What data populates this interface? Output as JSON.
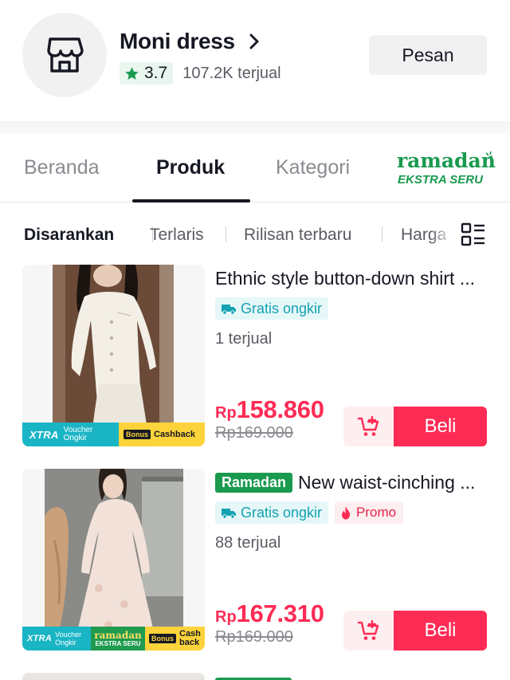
{
  "shop": {
    "name": "Moni dress",
    "rating": "3.7",
    "sold": "107.2K terjual",
    "message_button": "Pesan"
  },
  "tabs": [
    {
      "label": "Beranda",
      "active": false
    },
    {
      "label": "Produk",
      "active": true
    },
    {
      "label": "Kategori",
      "active": false
    }
  ],
  "campaign_tab": {
    "line1": "ramadan",
    "line2": "EKSTRA SERU"
  },
  "sort": {
    "options": [
      "Disarankan",
      "Terlaris",
      "Rilisan terbaru",
      "Harga"
    ],
    "active": "Disarankan"
  },
  "products": [
    {
      "title": "Ethnic style button-down shirt ...",
      "label_badge": "",
      "shipping_tag": "Gratis ongkir",
      "promo_tag": "",
      "sold": "1 terjual",
      "price_prefix": "Rp",
      "price": "158.860",
      "original_price": "Rp169.000",
      "banner": {
        "xtra": "XTRA",
        "voucher": "Voucher",
        "ongkir": "Ongkir",
        "bonus": "Bonus",
        "cashback": "Cashback"
      },
      "buy_label": "Beli"
    },
    {
      "title": "New waist-cinching ...",
      "label_badge": "Ramadan",
      "shipping_tag": "Gratis ongkir",
      "promo_tag": "Promo",
      "sold": "88 terjual",
      "price_prefix": "Rp",
      "price": "167.310",
      "original_price": "Rp169.000",
      "banner": {
        "xtra": "XTRA",
        "voucher": "Voucher",
        "ongkir": "Ongkir",
        "ramadan": "ramadan",
        "ekstra": "EKSTRA SERU",
        "bonus": "Bonus",
        "cash": "Cash",
        "back": "back"
      },
      "buy_label": "Beli"
    }
  ],
  "colors": {
    "accent_red": "#fe2c55",
    "ramadan_green": "#1a9a4f",
    "shipping_teal": "#14a2b3",
    "xtra_teal": "#1ab5c5",
    "cashback_yellow": "#fcd33a"
  },
  "icons": [
    "store-icon",
    "chevron-right-icon",
    "star-icon",
    "truck-icon",
    "flame-icon",
    "add-to-cart-icon",
    "list-layout-icon"
  ]
}
